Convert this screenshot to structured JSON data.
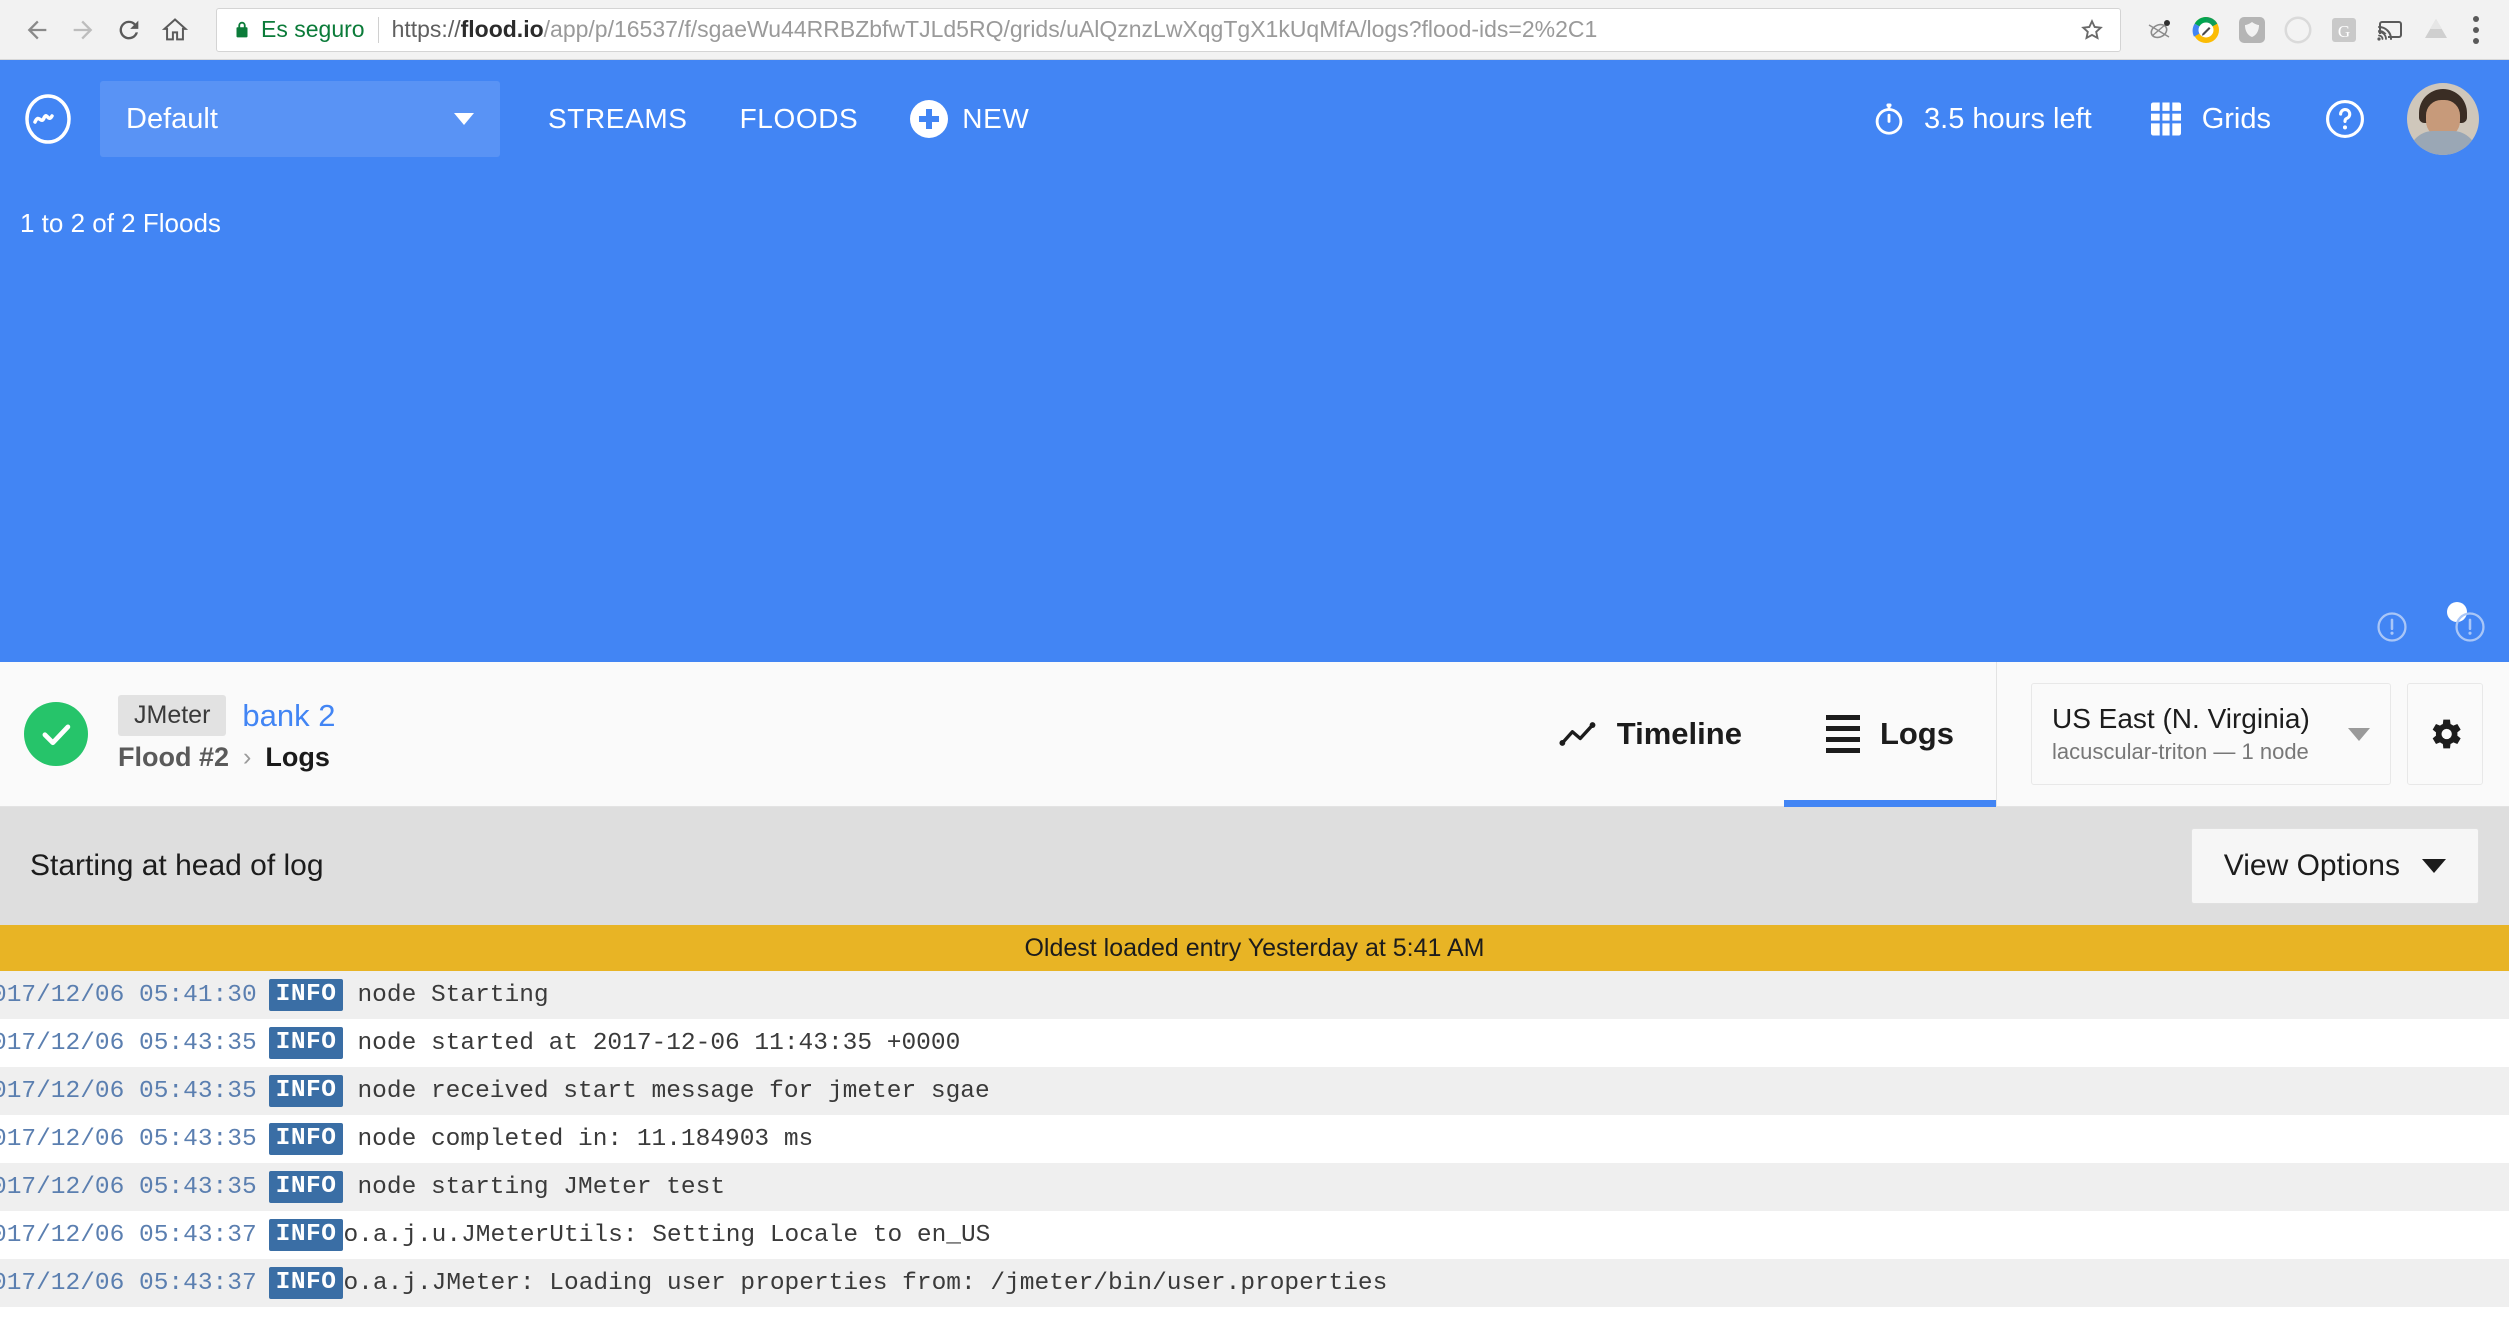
{
  "browser": {
    "back_icon": "arrow-left-icon",
    "forward_icon": "arrow-right-icon",
    "reload_icon": "reload-icon",
    "home_icon": "home-icon",
    "secure_label": "Es seguro",
    "lock_icon": "lock-icon",
    "url_protocol": "https://",
    "url_host": "flood.io",
    "url_path": "/app/p/16537/f/sgaeWu44RRBZbfwTJLd5RQ/grids/uAlQznzLwXqgTgX1kUqMfA/logs?flood-ids=2%2C1",
    "url_full": "https://flood.io/app/p/16537/f/sgaeWu44RRBZbfwTJLd5RQ/grids/uAlQznzLwXqgTgX1kUqMfA/logs?flood-ids=2%2C1",
    "bookmark_icon": "star-icon",
    "extensions": [
      {
        "name": "bug-extension-icon"
      },
      {
        "name": "colorful-pencil-extension-icon"
      },
      {
        "name": "shield-extension-icon"
      },
      {
        "name": "circle-extension-icon"
      },
      {
        "name": "grammarly-extension-icon"
      },
      {
        "name": "cast-icon"
      },
      {
        "name": "google-drive-icon"
      }
    ],
    "menu_icon": "kebab-menu-icon"
  },
  "app_header": {
    "logo_icon": "flood-wave-logo-icon",
    "project_label": "Default",
    "project_caret_icon": "chevron-down-icon",
    "nav": [
      {
        "label": "STREAMS",
        "name": "nav-streams"
      },
      {
        "label": "FLOODS",
        "name": "nav-floods"
      }
    ],
    "new_label": "NEW",
    "new_icon": "plus-circle-icon",
    "timer_icon": "stopwatch-icon",
    "hours_left": "3.5 hours left",
    "grids_icon": "grid-icon",
    "grids_label": "Grids",
    "help_icon": "question-circle-icon",
    "avatar_name": "user-avatar",
    "background_color": "#4285f4"
  },
  "blue_body": {
    "floods_count": "1 to 2 of 2 Floods",
    "warn_icon_1": "exclamation-circle-icon",
    "warn_icon_2": "exclamation-circle-icon",
    "dot_name": "pagination-dot"
  },
  "flood_bar": {
    "status_icon": "check-circle-icon",
    "status_color": "#26c46a",
    "tool_badge": "JMeter",
    "flood_name": "bank 2",
    "breadcrumb_parent": "Flood #2",
    "breadcrumb_separator": "›",
    "breadcrumb_current": "Logs",
    "tabs": [
      {
        "label": "Timeline",
        "icon": "line-chart-icon",
        "active": false
      },
      {
        "label": "Logs",
        "icon": "list-lines-icon",
        "active": true
      }
    ],
    "region_main": "US East (N. Virginia)",
    "region_sub": "lacuscular-triton — 1 node",
    "region_caret_icon": "chevron-down-icon",
    "gear_icon": "gear-icon"
  },
  "log_control": {
    "status_text": "Starting at head of log",
    "view_options_label": "View Options",
    "view_options_caret": "chevron-down-icon"
  },
  "log_area": {
    "oldest_banner": "Oldest loaded entry Yesterday at 5:41 AM",
    "banner_color": "#e8b425",
    "lines": [
      {
        "ts": "017/12/06 05:41:30",
        "level": "INFO",
        "message": "node Starting",
        "gap": true
      },
      {
        "ts": "017/12/06 05:43:35",
        "level": "INFO",
        "message": "node started at 2017-12-06 11:43:35 +0000",
        "gap": true
      },
      {
        "ts": "017/12/06 05:43:35",
        "level": "INFO",
        "message": "node received start message for jmeter sgae",
        "gap": true
      },
      {
        "ts": "017/12/06 05:43:35",
        "level": "INFO",
        "message": "node completed in: 11.184903 ms",
        "gap": true
      },
      {
        "ts": "017/12/06 05:43:35",
        "level": "INFO",
        "message": "node starting JMeter test",
        "gap": true
      },
      {
        "ts": "017/12/06 05:43:37",
        "level": "INFO",
        "message": "o.a.j.u.JMeterUtils: Setting Locale to en_US",
        "gap": false
      },
      {
        "ts": "017/12/06 05:43:37",
        "level": "INFO",
        "message": "o.a.j.JMeter: Loading user properties from: /jmeter/bin/user.properties",
        "gap": false
      }
    ]
  }
}
